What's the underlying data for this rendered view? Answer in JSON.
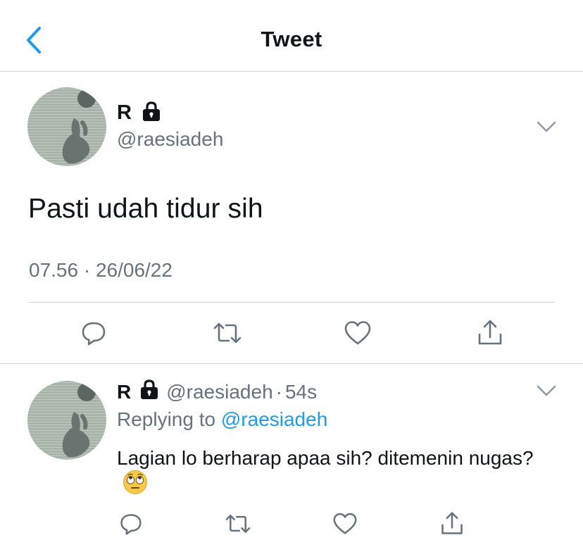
{
  "header": {
    "title": "Tweet",
    "back_icon": "chevron-left-icon"
  },
  "colors": {
    "accent": "#1d9bf0",
    "secondary_text": "#66727c",
    "divider": "#d6d9db"
  },
  "main_tweet": {
    "display_name": "R",
    "protected_icon": "lock-icon",
    "handle": "@raesiadeh",
    "text": "Pasti udah tidur sih",
    "timestamp": "07.56 · 26/06/22",
    "actions": [
      "reply-icon",
      "retweet-icon",
      "like-icon",
      "share-icon"
    ]
  },
  "reply_tweet": {
    "display_name": "R",
    "handle": "@raesiadeh",
    "separator": "·",
    "time": "54s",
    "replying_prefix": "Replying to ",
    "replying_handle": "@raesiadeh",
    "text": "Lagian lo berharap apaa sih? ditemenin nugas?",
    "emoji": "face-with-rolling-eyes",
    "actions": [
      "reply-icon",
      "retweet-icon",
      "like-icon",
      "share-icon"
    ]
  }
}
